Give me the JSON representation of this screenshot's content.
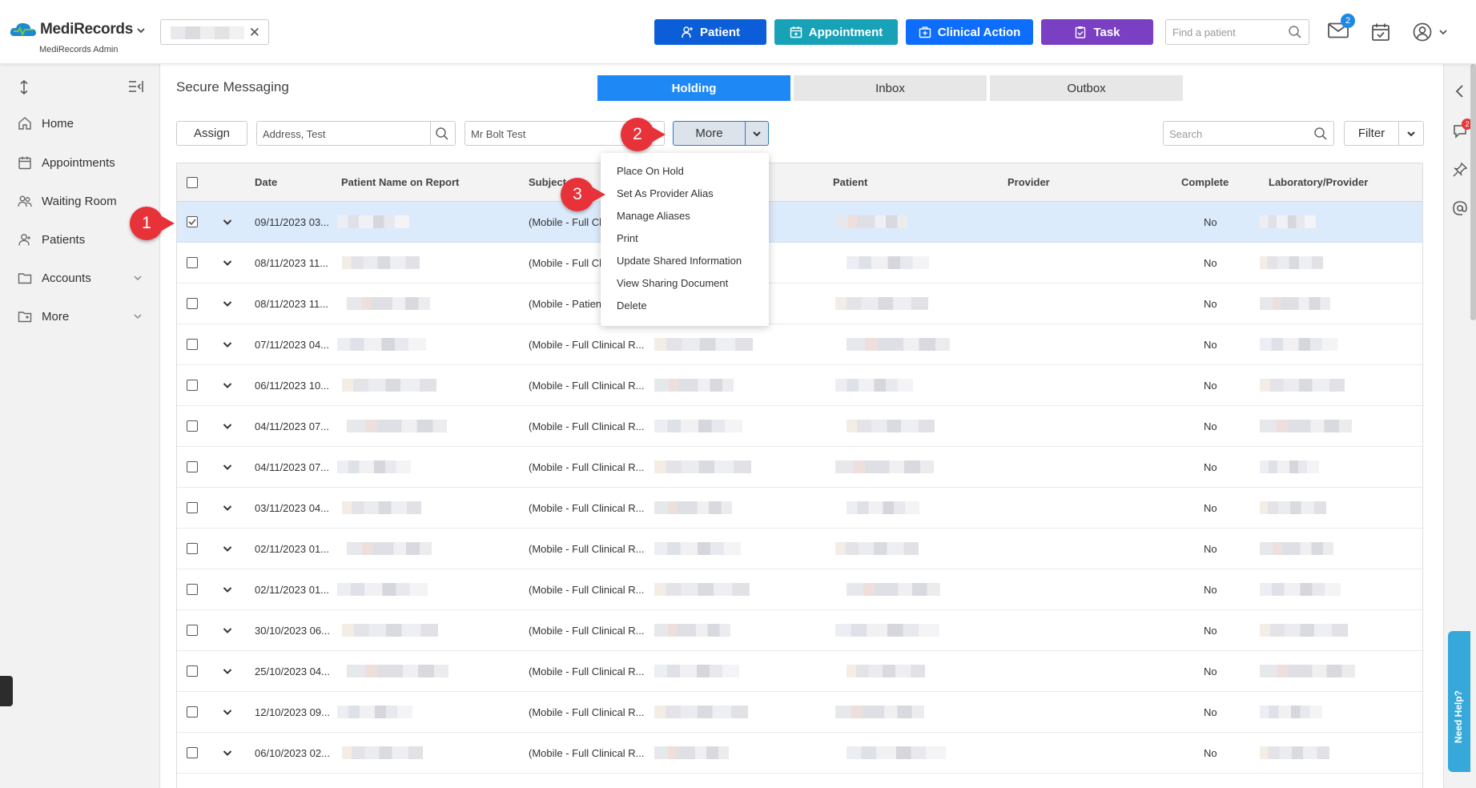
{
  "app": {
    "brand": "MediRecords",
    "brand_sub": "MediRecords Admin"
  },
  "topbar": {
    "buttons": [
      {
        "label": "Patient",
        "color": "#0b5ed7"
      },
      {
        "label": "Appointment",
        "color": "#17a2b8"
      },
      {
        "label": "Clinical Action",
        "color": "#0d6efd"
      },
      {
        "label": "Task",
        "color": "#7b3fc4"
      }
    ],
    "find_patient_placeholder": "Find a patient",
    "mail_badge": "2"
  },
  "sidebar": {
    "items": [
      {
        "label": "Home",
        "icon": "home-icon"
      },
      {
        "label": "Appointments",
        "icon": "calendar-icon"
      },
      {
        "label": "Waiting Room",
        "icon": "people-icon"
      },
      {
        "label": "Patients",
        "icon": "person-icon"
      },
      {
        "label": "Accounts",
        "icon": "folder-icon"
      },
      {
        "label": "More",
        "icon": "folder-icon"
      }
    ]
  },
  "page": {
    "title": "Secure Messaging",
    "tabs": [
      {
        "label": "Holding",
        "active": true
      },
      {
        "label": "Inbox",
        "active": false
      },
      {
        "label": "Outbox",
        "active": false
      }
    ]
  },
  "toolbar": {
    "assign_label": "Assign",
    "address_value": "Address, Test",
    "provider_value": "Mr Bolt Test",
    "more_label": "More",
    "search_placeholder": "Search",
    "filter_label": "Filter"
  },
  "menu": {
    "items": [
      "Place On Hold",
      "Set As Provider Alias",
      "Manage Aliases",
      "Print",
      "Update Shared Information",
      "View Sharing Document",
      "Delete"
    ]
  },
  "table": {
    "columns": [
      "Date",
      "Patient Name on Report",
      "Subject",
      "Patient",
      "Provider",
      "Complete",
      "Laboratory/Provider"
    ],
    "rows": [
      {
        "date": "09/11/2023 03...",
        "subject": "(Mobile - Full Cli",
        "complete": "No",
        "selected": true
      },
      {
        "date": "08/11/2023 11...",
        "subject": "(Mobile - Full Cli",
        "complete": "No",
        "selected": false
      },
      {
        "date": "08/11/2023 11...",
        "subject": "(Mobile - Patien",
        "complete": "No",
        "selected": false
      },
      {
        "date": "07/11/2023 04...",
        "subject": "(Mobile - Full Clinical R...",
        "complete": "No",
        "selected": false
      },
      {
        "date": "06/11/2023 10...",
        "subject": "(Mobile - Full Clinical R...",
        "complete": "No",
        "selected": false
      },
      {
        "date": "04/11/2023 07...",
        "subject": "(Mobile - Full Clinical R...",
        "complete": "No",
        "selected": false
      },
      {
        "date": "04/11/2023 07...",
        "subject": "(Mobile - Full Clinical R...",
        "complete": "No",
        "selected": false
      },
      {
        "date": "03/11/2023 04...",
        "subject": "(Mobile - Full Clinical R...",
        "complete": "No",
        "selected": false
      },
      {
        "date": "02/11/2023 01...",
        "subject": "(Mobile - Full Clinical R...",
        "complete": "No",
        "selected": false
      },
      {
        "date": "02/11/2023 01...",
        "subject": "(Mobile - Full Clinical R...",
        "complete": "No",
        "selected": false
      },
      {
        "date": "30/10/2023 06...",
        "subject": "(Mobile - Full Clinical R...",
        "complete": "No",
        "selected": false
      },
      {
        "date": "25/10/2023 04...",
        "subject": "(Mobile - Full Clinical R...",
        "complete": "No",
        "selected": false
      },
      {
        "date": "12/10/2023 09...",
        "subject": "(Mobile - Full Clinical R...",
        "complete": "No",
        "selected": false
      },
      {
        "date": "06/10/2023 02...",
        "subject": "(Mobile - Full Clinical R...",
        "complete": "No",
        "selected": false
      }
    ]
  },
  "steps": [
    "1",
    "2",
    "3"
  ],
  "right_rail": {
    "notification_badge": "2",
    "help_label": "Need Help?"
  },
  "colors": {
    "accent": "#1e88f5",
    "selected_row": "#dcebfb",
    "step_marker": "#e8323a"
  }
}
